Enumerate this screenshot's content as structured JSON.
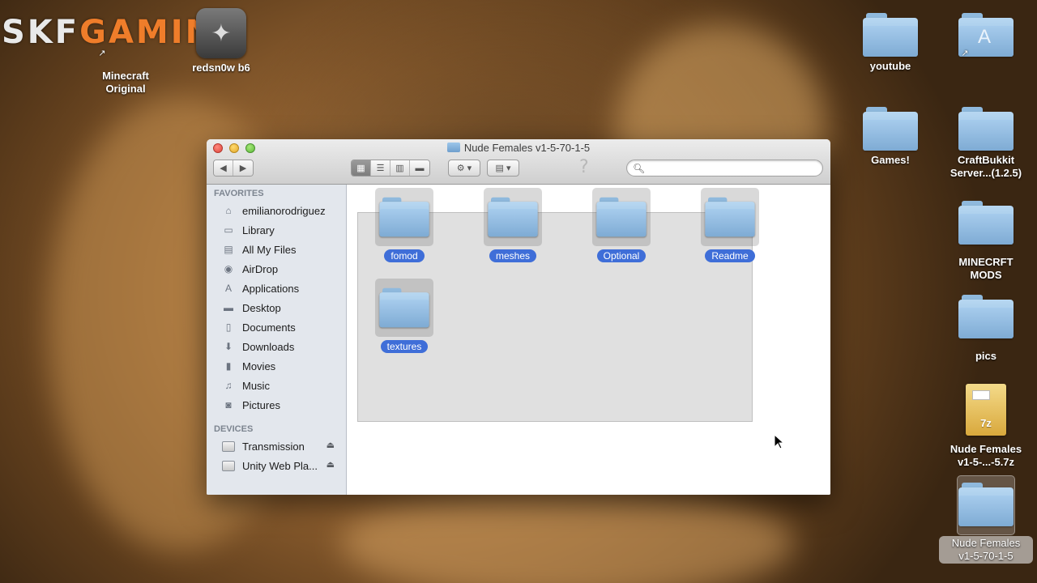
{
  "watermark": {
    "left": "SKF",
    "right": "GAMING"
  },
  "desktop": {
    "top_left": [
      {
        "label": "Minecraft\nOriginal",
        "label_a": "Minecraft",
        "label_b": "Original"
      },
      {
        "label": "redsn0w b6"
      }
    ],
    "right": [
      {
        "label": "youtube"
      },
      {
        "label": "Games!"
      },
      {
        "label_a": "CraftBukkit",
        "label_b": "Server...(1.2.5)"
      },
      {
        "label_a": "MINECRFT",
        "label_b": "MODS"
      },
      {
        "label": "pics"
      },
      {
        "label_a": "Nude Females",
        "label_b": "v1-5-...-5.7z",
        "badge": "7z"
      },
      {
        "label_a": "Nude Females",
        "label_b": "v1-5-70-1-5"
      }
    ]
  },
  "window": {
    "title": "Nude Females v1-5-70-1-5",
    "help_glyph": "?",
    "search": {
      "value": "",
      "placeholder": ""
    },
    "sidebar": {
      "favorites_header": "FAVORITES",
      "favorites": [
        {
          "label": "emilianorodriguez",
          "icon": "home-icon"
        },
        {
          "label": "Library",
          "icon": "folder-icon"
        },
        {
          "label": "All My Files",
          "icon": "all-files-icon"
        },
        {
          "label": "AirDrop",
          "icon": "airdrop-icon"
        },
        {
          "label": "Applications",
          "icon": "applications-icon"
        },
        {
          "label": "Desktop",
          "icon": "desktop-icon"
        },
        {
          "label": "Documents",
          "icon": "documents-icon"
        },
        {
          "label": "Downloads",
          "icon": "downloads-icon"
        },
        {
          "label": "Movies",
          "icon": "movies-icon"
        },
        {
          "label": "Music",
          "icon": "music-icon"
        },
        {
          "label": "Pictures",
          "icon": "pictures-icon"
        }
      ],
      "devices_header": "DEVICES",
      "devices": [
        {
          "label": "Transmission",
          "icon": "drive-icon"
        },
        {
          "label": "Unity Web Pla...",
          "icon": "drive-icon"
        }
      ]
    },
    "items": [
      {
        "label": "fomod"
      },
      {
        "label": "meshes"
      },
      {
        "label": "Optional"
      },
      {
        "label": "Readme"
      },
      {
        "label": "textures"
      }
    ]
  },
  "colors": {
    "selection_pill": "#3f6ed8",
    "sidebar_bg": "#e3e7ed"
  }
}
